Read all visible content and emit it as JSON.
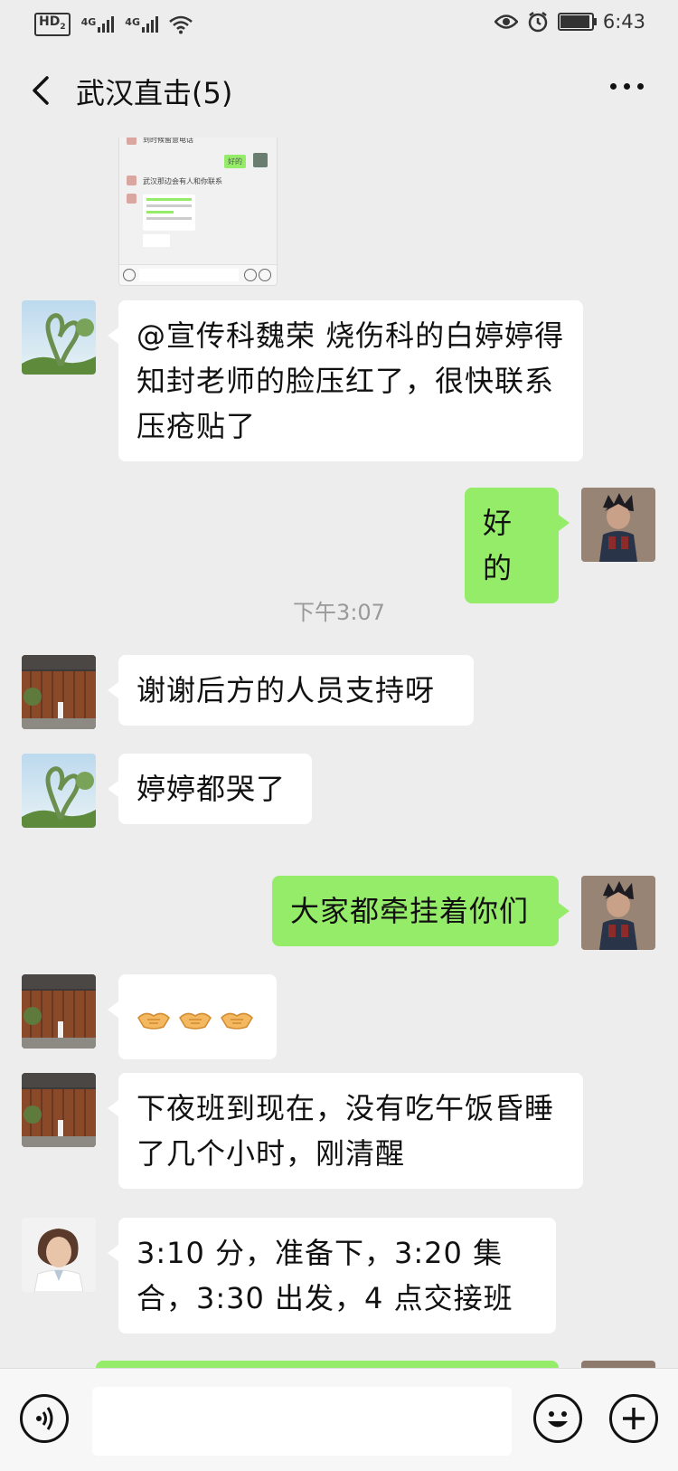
{
  "status_bar": {
    "hd_label": "HD",
    "hd_sub": "2",
    "network_1": "4G",
    "network_2": "4G",
    "time": "6:43",
    "battery_level": 0.9
  },
  "header": {
    "title": "武汉直击(5)"
  },
  "shared_image": {
    "line_1": "到时候留意电话",
    "reply": "好的",
    "line_2": "武汉那边会有人和你联系"
  },
  "messages": [
    {
      "side": "left",
      "avatar": "avatar-plant",
      "text": "@宣传科魏荣  烧伤科的白婷婷得知封老师的脸压红了，很快联系压疮贴了"
    },
    {
      "side": "right",
      "avatar": "avatar-anime",
      "text": "好的"
    },
    {
      "type": "timestamp",
      "text": "下午3:07"
    },
    {
      "side": "left",
      "avatar": "avatar-house",
      "text": "谢谢后方的人员支持呀"
    },
    {
      "side": "left",
      "avatar": "avatar-plant",
      "text": "婷婷都哭了"
    },
    {
      "side": "right",
      "avatar": "avatar-anime",
      "text": "大家都牵挂着你们"
    },
    {
      "side": "left",
      "avatar": "avatar-house",
      "emoji": "handshake-icon x3"
    },
    {
      "side": "left",
      "avatar": "avatar-house",
      "text": "下夜班到现在，没有吃午饭昏睡了几个小时，刚清醒"
    },
    {
      "side": "left",
      "avatar": "avatar-doctor",
      "text": "3:10 分，准备下，3:20 集合，3:30 出发，4 点交接班"
    }
  ],
  "input_bar": {
    "voice_icon": "voice-icon",
    "emoji_icon": "emoji-icon",
    "plus_icon": "plus-icon"
  }
}
